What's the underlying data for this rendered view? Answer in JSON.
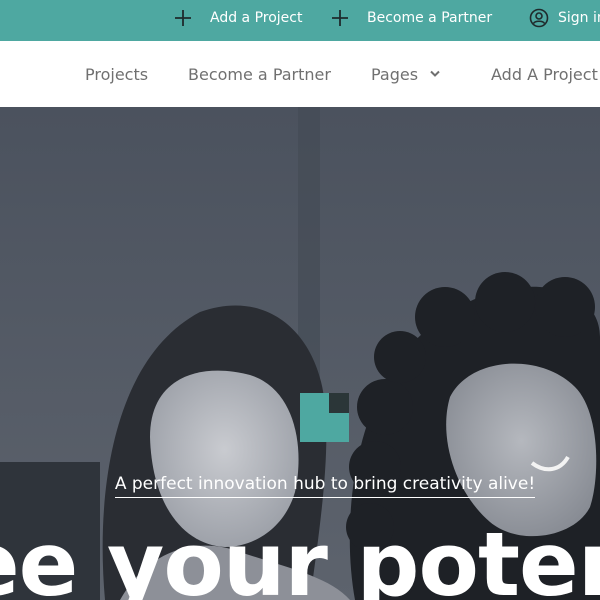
{
  "topbar": {
    "background": "#4ea8a1",
    "add_project": {
      "icon": "plus-icon",
      "label": "Add a Project"
    },
    "become_partner": {
      "icon": "plus-icon",
      "label": "Become a Partner"
    },
    "sign_in": {
      "icon": "user-circle-icon",
      "label": "Sign in"
    }
  },
  "nav": {
    "items": [
      {
        "label": "Projects"
      },
      {
        "label": "Become a Partner"
      },
      {
        "label": "Pages",
        "icon": "chevron-down-icon"
      },
      {
        "label": "Add A Project"
      }
    ]
  },
  "hero": {
    "tagline": "A perfect innovation hub to bring creativity alive!",
    "headline": "ee your poten",
    "accent_color": "#4ea8a1"
  }
}
